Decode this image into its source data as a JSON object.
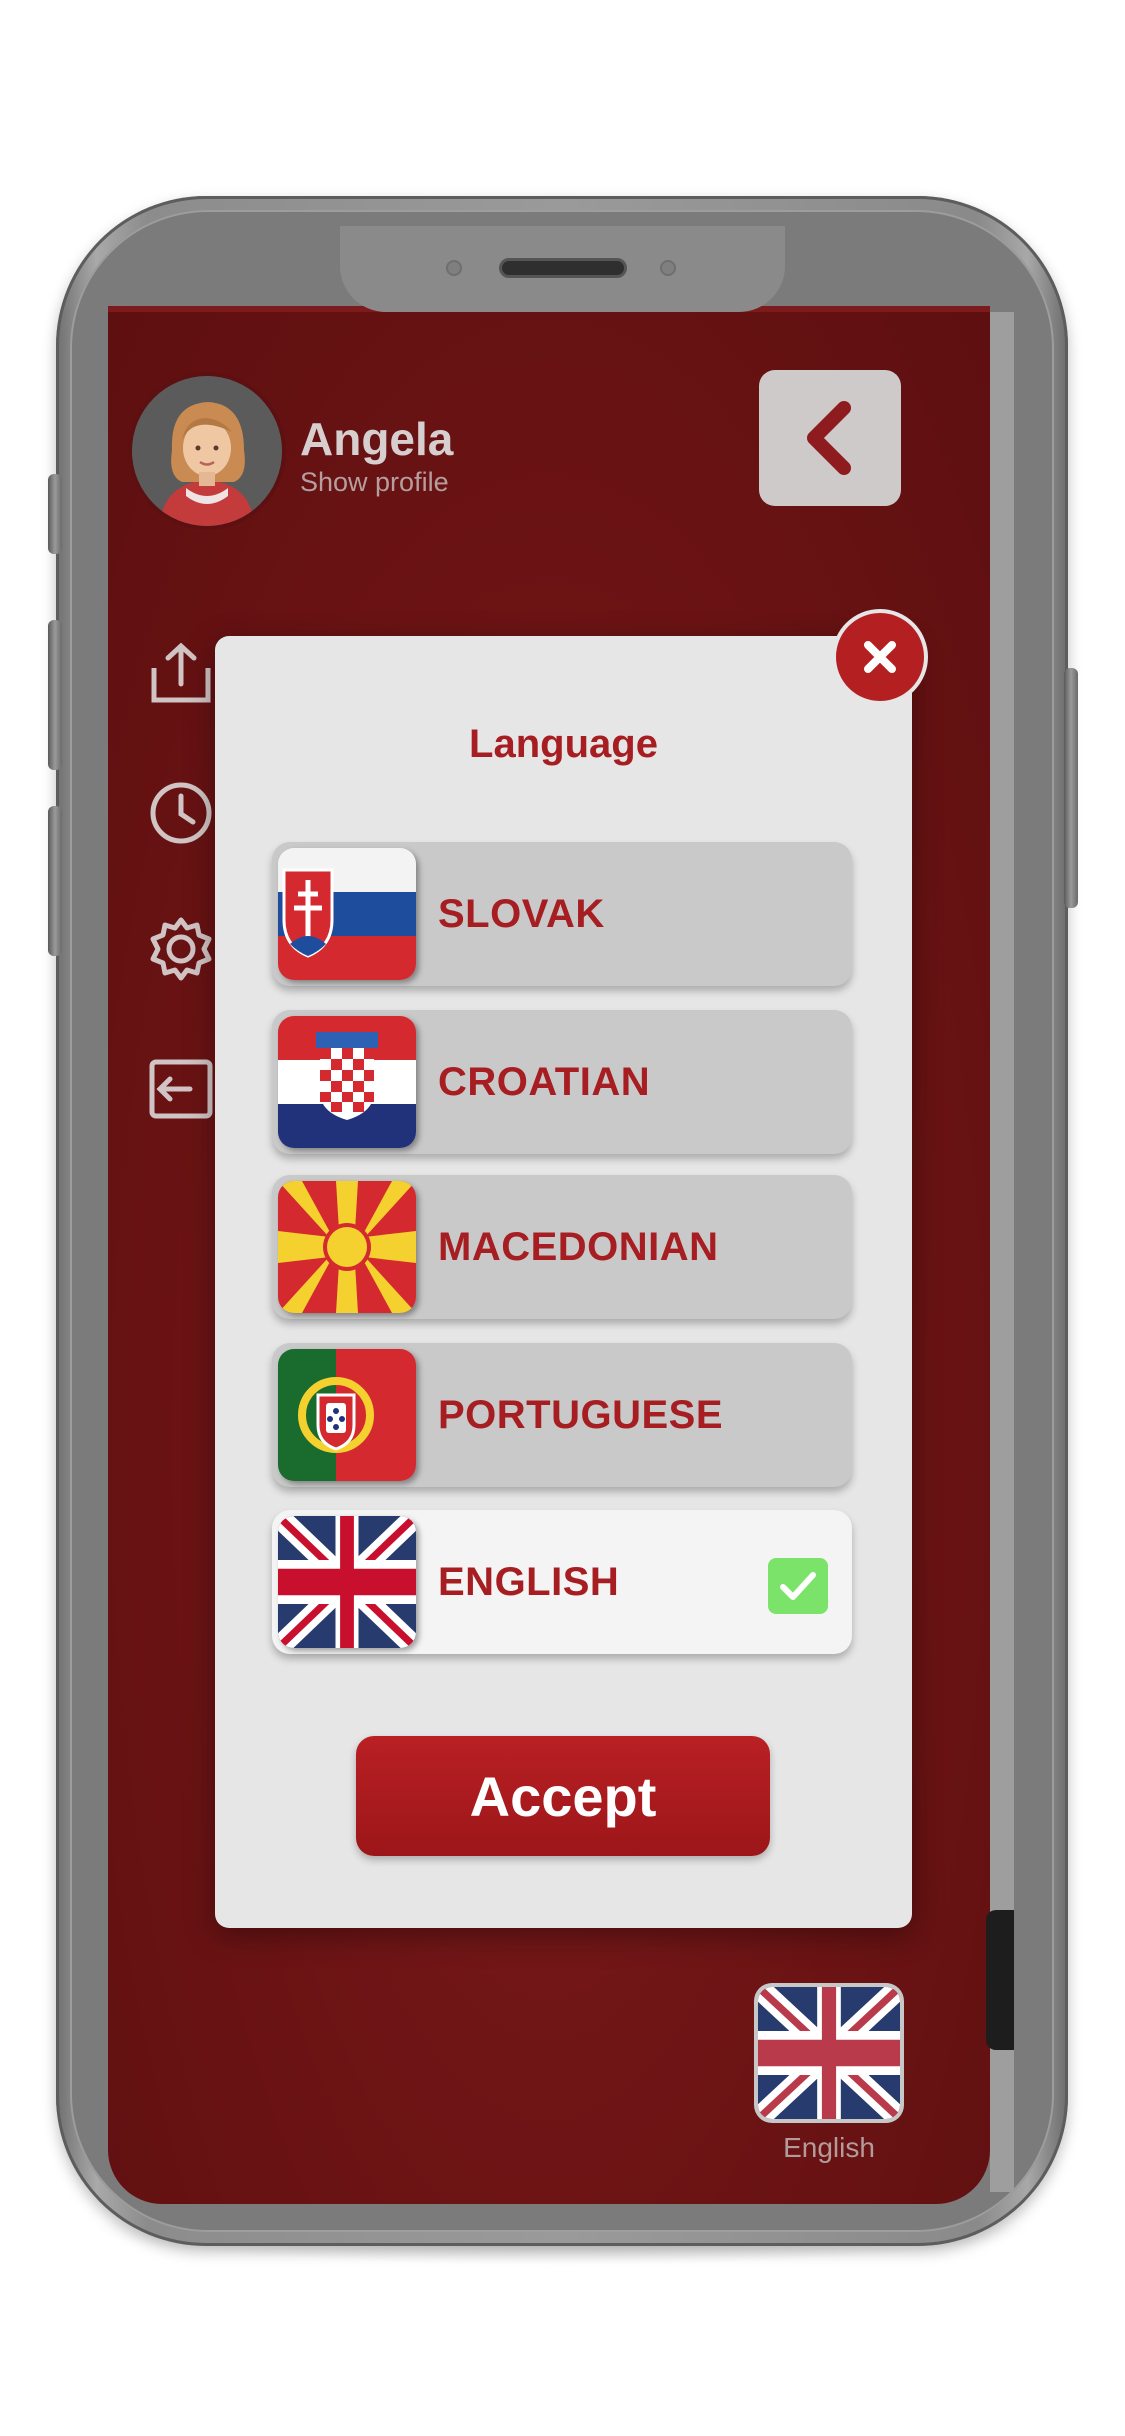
{
  "profile": {
    "name": "Angela",
    "subtitle": "Show profile"
  },
  "modal": {
    "title": "Language",
    "languages": [
      {
        "label": "SLOVAK",
        "flag": "slovakia-flag",
        "selected": false
      },
      {
        "label": "CROATIAN",
        "flag": "croatia-flag",
        "selected": false
      },
      {
        "label": "MACEDONIAN",
        "flag": "north-macedonia-flag",
        "selected": false
      },
      {
        "label": "PORTUGUESE",
        "flag": "portugal-flag",
        "selected": false
      },
      {
        "label": "ENGLISH",
        "flag": "united-kingdom-flag",
        "selected": true
      }
    ],
    "accept_label": "Accept",
    "close_icon": "close-icon"
  },
  "menu_icons": [
    "share-icon",
    "history-clock-icon",
    "settings-gear-icon",
    "logout-icon"
  ],
  "current_language": {
    "label": "English",
    "flag": "united-kingdom-flag"
  },
  "colors": {
    "brand_red": "#a71e22",
    "background_dark_red": "#6b1314",
    "modal_background": "#e6e6e6",
    "check_green": "#7ce36a"
  }
}
